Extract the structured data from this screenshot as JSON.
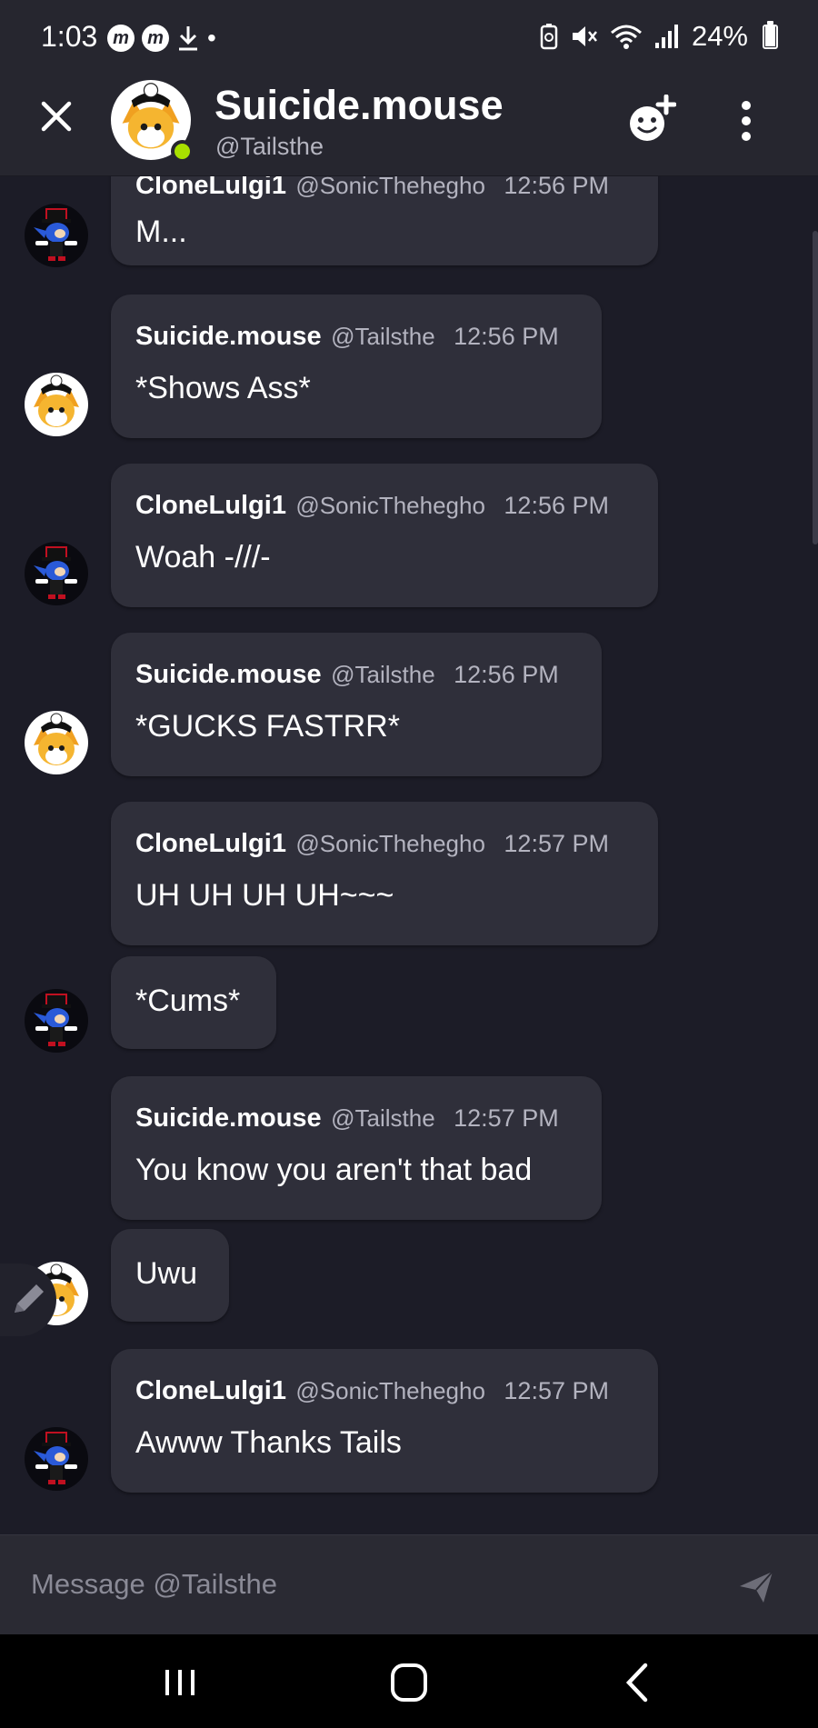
{
  "status_bar": {
    "time": "1:03",
    "battery": "24%"
  },
  "header": {
    "name": "Suicide.mouse",
    "handle": "@Tailsthe"
  },
  "messages": [
    {
      "author": "CloneLulgi1",
      "handle": "@SonicThehegho",
      "time": "12:56 PM",
      "text": "M..."
    },
    {
      "author": "Suicide.mouse",
      "handle": "@Tailsthe",
      "time": "12:56 PM",
      "text": "*Shows Ass*"
    },
    {
      "author": "CloneLulgi1",
      "handle": "@SonicThehegho",
      "time": "12:56 PM",
      "text": "Woah -///-"
    },
    {
      "author": "Suicide.mouse",
      "handle": "@Tailsthe",
      "time": "12:56 PM",
      "text": "*GUCKS FASTRR*"
    },
    {
      "author": "CloneLulgi1",
      "handle": "@SonicThehegho",
      "time": "12:57 PM",
      "text": "UH UH UH UH~~~"
    },
    {
      "text": "*Cums*"
    },
    {
      "author": "Suicide.mouse",
      "handle": "@Tailsthe",
      "time": "12:57 PM",
      "text": "You know you aren't that bad"
    },
    {
      "text": "Uwu"
    },
    {
      "author": "CloneLulgi1",
      "handle": "@SonicThehegho",
      "time": "12:57 PM",
      "text": "Awww Thanks Tails"
    }
  ],
  "composer": {
    "placeholder": "Message @Tailsthe"
  },
  "colors": {
    "background": "#1c1c27",
    "bubble": "#2f2f3a",
    "header": "#26262f",
    "online": "#a8e000"
  },
  "icons": [
    "close-icon",
    "add-friend-icon",
    "more-vertical-icon",
    "send-icon",
    "pencil-icon",
    "recents-icon",
    "home-icon",
    "back-icon"
  ]
}
